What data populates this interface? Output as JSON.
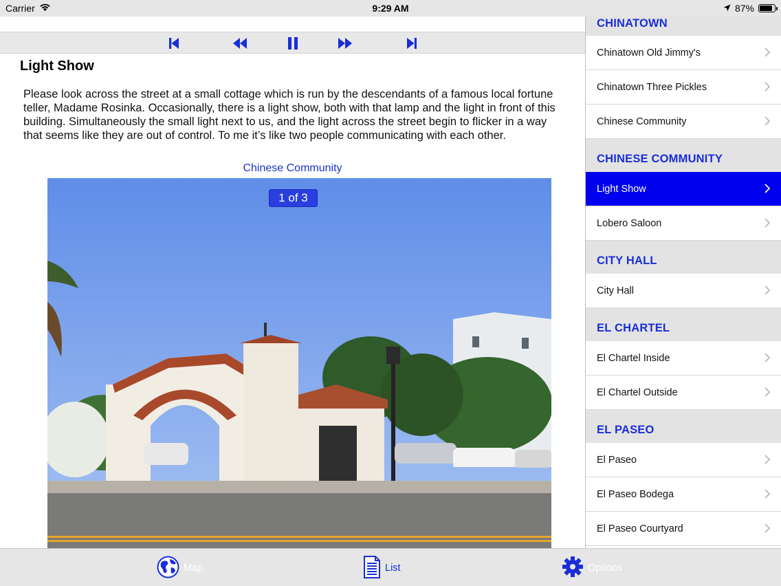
{
  "status_bar": {
    "carrier": "Carrier",
    "time": "9:29 AM",
    "battery": "87%",
    "battery_level": 0.87,
    "icons": [
      "wifi-icon",
      "location-arrow-icon",
      "battery-icon"
    ]
  },
  "media_controls": {
    "icons": [
      "skip-to-start-icon",
      "rewind-icon",
      "pause-icon",
      "fast-forward-icon",
      "skip-to-end-icon"
    ],
    "color": "#1a2ed8"
  },
  "detail": {
    "title": "Light Show",
    "description": "Please look across the street at a small cottage which is run by the descendants of a famous local fortune teller, Madame Rosinka. Occasionally, there is a light show, both with that lamp and the light in front of this building.  Simultaneously the small light next to us, and the light across the street begin to flicker in a way that seems like they are out of control. To me it’s like two people communicating with each other.",
    "photo_caption": "Chinese Community",
    "photo_counter": "1 of 3"
  },
  "sidebar": {
    "sections": [
      {
        "header": "CHINATOWN",
        "items": [
          {
            "label": "Chinatown Old Jimmy's",
            "selected": false
          },
          {
            "label": "Chinatown Three Pickles",
            "selected": false
          },
          {
            "label": "Chinese Community",
            "selected": false
          }
        ]
      },
      {
        "header": "CHINESE COMMUNITY",
        "items": [
          {
            "label": "Light Show",
            "selected": true
          },
          {
            "label": "Lobero Saloon",
            "selected": false
          }
        ]
      },
      {
        "header": "CITY HALL",
        "items": [
          {
            "label": "City Hall",
            "selected": false
          }
        ]
      },
      {
        "header": "EL CHARTEL",
        "items": [
          {
            "label": "El Chartel Inside",
            "selected": false
          },
          {
            "label": "El Chartel Outside",
            "selected": false
          }
        ]
      },
      {
        "header": "EL PASEO",
        "items": [
          {
            "label": "El Paseo",
            "selected": false
          },
          {
            "label": "El Paseo Bodega",
            "selected": false
          },
          {
            "label": "El Paseo Courtyard",
            "selected": false
          }
        ]
      }
    ]
  },
  "tab_bar": {
    "tabs": [
      {
        "label": "Map",
        "icon": "globe-icon",
        "active": false
      },
      {
        "label": "List",
        "icon": "document-list-icon",
        "active": true
      },
      {
        "label": "Options",
        "icon": "gear-icon",
        "active": false
      }
    ]
  },
  "colors": {
    "accent": "#1a2ed8",
    "selected_row": "#0000ee",
    "header_bg": "#e3e3e3"
  }
}
